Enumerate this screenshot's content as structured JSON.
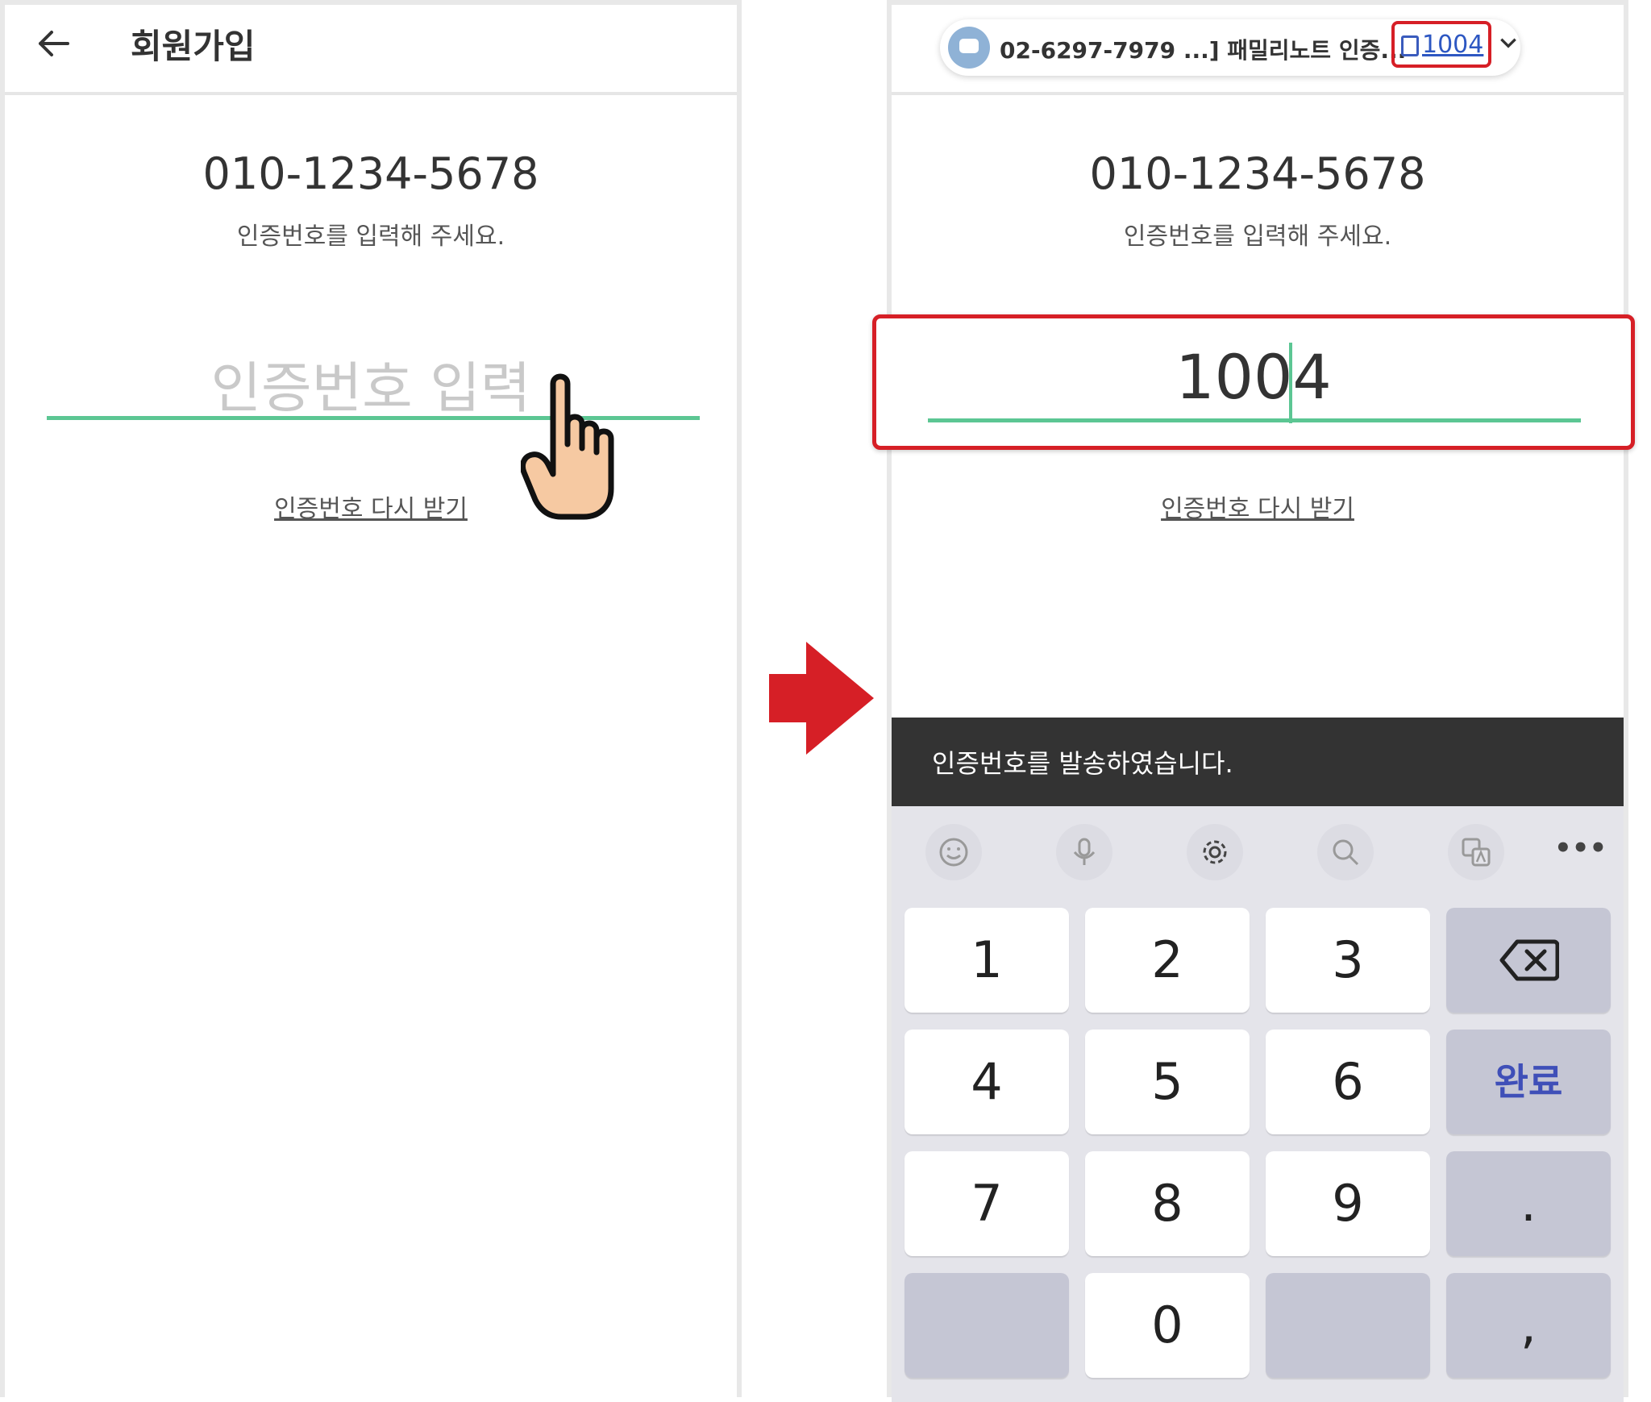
{
  "left_screen": {
    "title": "회원가입",
    "phone_number": "010-1234-5678",
    "guide_text": "인증번호를 입력해 주세요.",
    "code_placeholder": "인증번호 입력",
    "resend_link": "인증번호 다시 받기"
  },
  "right_screen": {
    "notification": {
      "text": "02-6297-7979 ...] 패밀리노트 인증...",
      "code_chip": "1004"
    },
    "phone_number": "010-1234-5678",
    "guide_text": "인증번호를 입력해 주세요.",
    "code_value": "1004",
    "resend_link": "인증번호 다시 받기",
    "toast": "인증번호를 발송하였습니다.",
    "keyboard": {
      "more_label": "•••",
      "keys": [
        "1",
        "2",
        "3",
        "4",
        "5",
        "6",
        "7",
        "8",
        "9",
        "0"
      ],
      "done_label": "완료",
      "period": ".",
      "comma": ","
    }
  },
  "colors": {
    "accent_green": "#5cc693",
    "highlight_red": "#d61f26",
    "toast_bg": "#333333",
    "keyboard_bg": "#e4e4ea"
  }
}
